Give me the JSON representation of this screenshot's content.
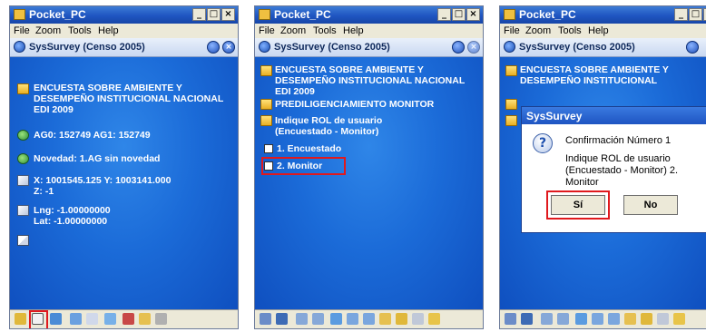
{
  "window": {
    "title": "Pocket_PC",
    "min": "_",
    "max": "□",
    "close": "×"
  },
  "menu": {
    "file": "File",
    "zoom": "Zoom",
    "tools": "Tools",
    "help": "Help"
  },
  "app": {
    "title": "SysSurvey  (Censo 2005)"
  },
  "panel1": {
    "survey_title": "ENCUESTA SOBRE AMBIENTE Y DESEMPEÑO INSTITUCIONAL NACIONAL EDI 2009",
    "ag_line": "AG0: 152749   AG1: 152749",
    "novedad": "Novedad:  1.AG sin novedad",
    "xy_line": "X: 1001545.125   Y: 1003141.000",
    "z_line": "Z: -1",
    "lng": "Lng: -1.00000000",
    "lat": "Lat: -1.00000000"
  },
  "panel2": {
    "survey_title": "ENCUESTA SOBRE AMBIENTE Y DESEMPEÑO INSTITUCIONAL NACIONAL EDI 2009",
    "prediligenciamiento": "PREDILIGENCIAMIENTO MONITOR",
    "question": "Indique ROL de usuario (Encuestado - Monitor)",
    "option1": "1. Encuestado",
    "option2": "2. Monitor"
  },
  "panel3": {
    "survey_title": "ENCUESTA SOBRE AMBIENTE Y DESEMPEÑO INSTITUCIONAL",
    "dialog": {
      "title": "SysSurvey",
      "heading": "Confirmación Número 1",
      "message": "Indique ROL de usuario (Encuestado - Monitor) 2. Monitor",
      "yes": "Sí",
      "no": "No",
      "question_mark": "?"
    }
  },
  "colors": {
    "highlight": "#e0191d",
    "content_blue": "#1b6bd8",
    "title_blue": "#1f55c1"
  }
}
